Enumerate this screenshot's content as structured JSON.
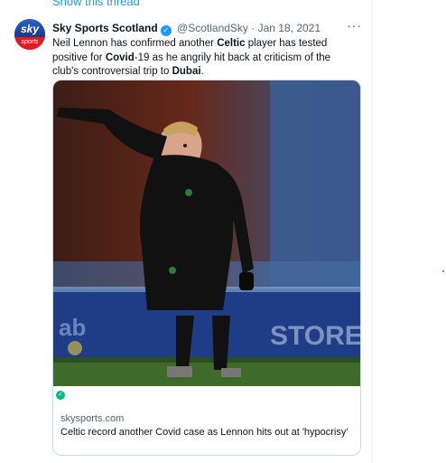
{
  "thread": {
    "show_label": "Show this thread"
  },
  "tweet": {
    "author_name": "Sky Sports Scotland",
    "handle": "@ScotlandSky",
    "separator": "·",
    "date": "Jan 18, 2021",
    "more": "···",
    "text_parts": [
      "Neil Lennon has confirmed another ",
      "Celtic",
      " player has tested positive for ",
      "Covid",
      "-19 as he angrily hit back at criticism of the club's controversial trip to ",
      "Dubai",
      "."
    ],
    "avatar": {
      "top_text": "sky",
      "bottom_text": "sports"
    },
    "verified_icon": "verified-badge-icon"
  },
  "card": {
    "domain": "skysports.com",
    "title": "Celtic record another Covid case as Lennon hits out at 'hypocrisy'",
    "badge_icon": "check-icon",
    "colors": {
      "card_border": "#cfd9de",
      "badge": "#00ba7c",
      "accent": "#1d9bf0"
    }
  }
}
